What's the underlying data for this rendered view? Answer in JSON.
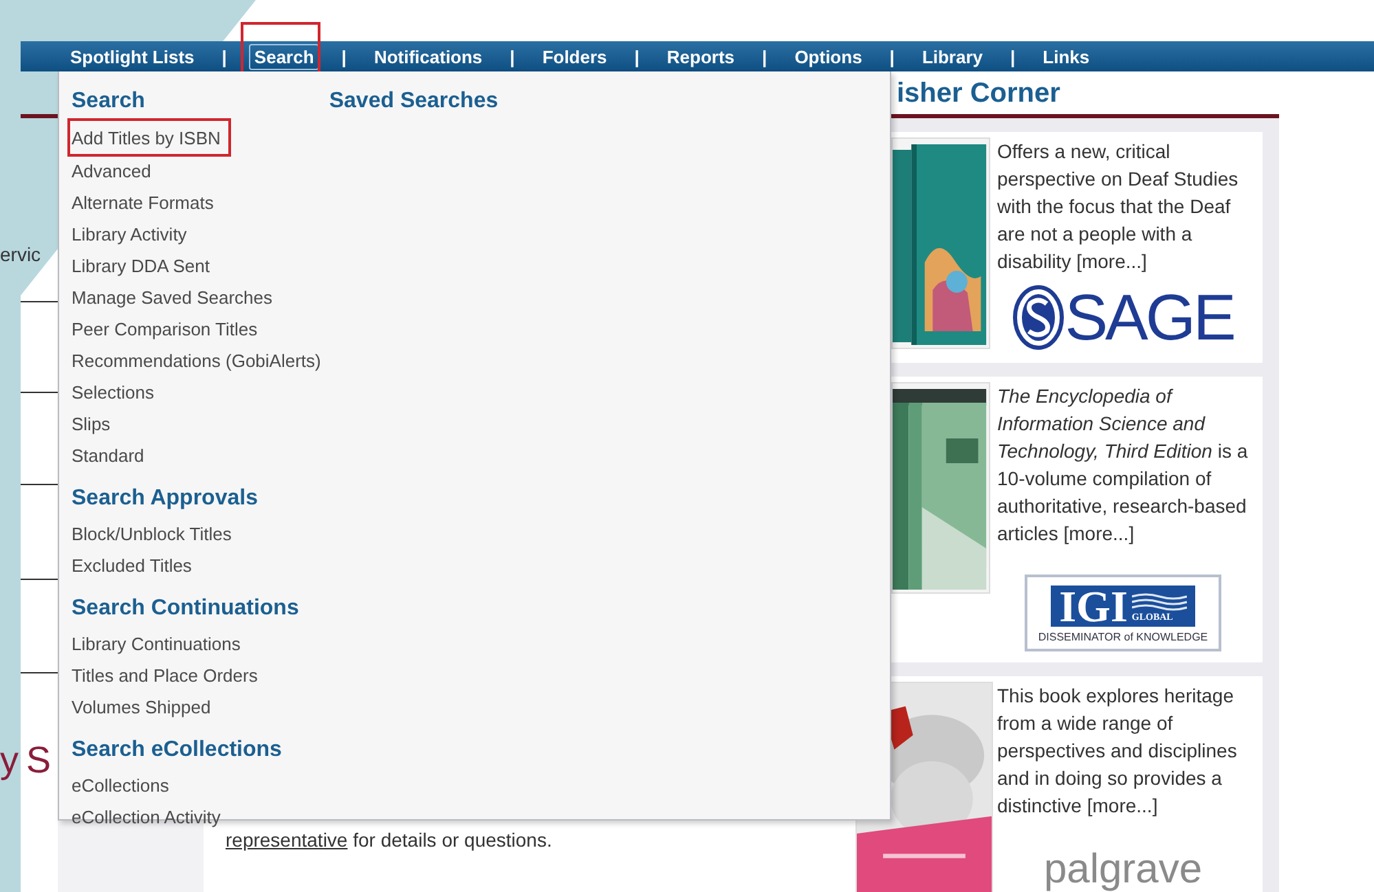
{
  "nav": {
    "items": [
      {
        "label": "Spotlight Lists",
        "selected": false,
        "highlighted": false
      },
      {
        "label": "Search",
        "selected": true,
        "highlighted": true
      },
      {
        "label": "Notifications",
        "selected": false,
        "highlighted": false
      },
      {
        "label": "Folders",
        "selected": false,
        "highlighted": false
      },
      {
        "label": "Reports",
        "selected": false,
        "highlighted": false
      },
      {
        "label": "Options",
        "selected": false,
        "highlighted": false
      },
      {
        "label": "Library",
        "selected": false,
        "highlighted": false
      },
      {
        "label": "Links",
        "selected": false,
        "highlighted": false
      }
    ],
    "separators": [
      "|",
      "|",
      "|",
      "|",
      "|",
      "|",
      "|"
    ]
  },
  "menu": {
    "columns": [
      {
        "sections": [
          {
            "heading": "Search",
            "items": [
              {
                "label": "Add Titles by ISBN",
                "highlighted": true
              },
              {
                "label": "Advanced",
                "highlighted": false
              },
              {
                "label": "Alternate Formats",
                "highlighted": false
              },
              {
                "label": "Library Activity",
                "highlighted": false
              },
              {
                "label": "Library DDA Sent",
                "highlighted": false
              },
              {
                "label": "Manage Saved Searches",
                "highlighted": false
              },
              {
                "label": "Peer Comparison Titles",
                "highlighted": false
              },
              {
                "label": "Recommendations (GobiAlerts)",
                "highlighted": false
              },
              {
                "label": "Selections",
                "highlighted": false
              },
              {
                "label": "Slips",
                "highlighted": false
              },
              {
                "label": "Standard",
                "highlighted": false
              }
            ]
          },
          {
            "heading": "Search Approvals",
            "items": [
              {
                "label": "Block/Unblock Titles",
                "highlighted": false
              },
              {
                "label": "Excluded Titles",
                "highlighted": false
              }
            ]
          },
          {
            "heading": "Search Continuations",
            "items": [
              {
                "label": "Library Continuations",
                "highlighted": false
              },
              {
                "label": "Titles and Place Orders",
                "highlighted": false
              },
              {
                "label": "Volumes Shipped",
                "highlighted": false
              }
            ]
          },
          {
            "heading": "Search eCollections",
            "items": [
              {
                "label": "eCollections",
                "highlighted": false
              },
              {
                "label": "eCollection Activity",
                "highlighted": false
              }
            ]
          }
        ]
      },
      {
        "sections": [
          {
            "heading": "Saved Searches"
          }
        ]
      }
    ]
  },
  "background": {
    "side_text": "ervic",
    "side_heading": "y S",
    "note_link": "representative",
    "note_text": " for details or questions."
  },
  "publisher_corner": {
    "title": "isher Corner",
    "cards": [
      {
        "description": "Offers a new, critical perspective on Deaf Studies with the focus that the Deaf are not a people with a disability [more...]",
        "logo": {
          "kind": "sage",
          "text": "SAGE"
        }
      },
      {
        "description": "*The Encyclopedia of Information Science and Technology, Third Edition* is a 10-volume compilation of authoritative, research-based articles [more...]",
        "logo": {
          "kind": "igi",
          "text": "IGI",
          "subtext": "GLOBAL",
          "tagline": "DISSEMINATOR of KNOWLEDGE"
        }
      },
      {
        "description": "This book explores heritage from a wide range of perspectives and disciplines and in doing so provides a distinctive [more...]",
        "logo": {
          "kind": "palgrave",
          "text": "palgrave"
        }
      }
    ]
  }
}
